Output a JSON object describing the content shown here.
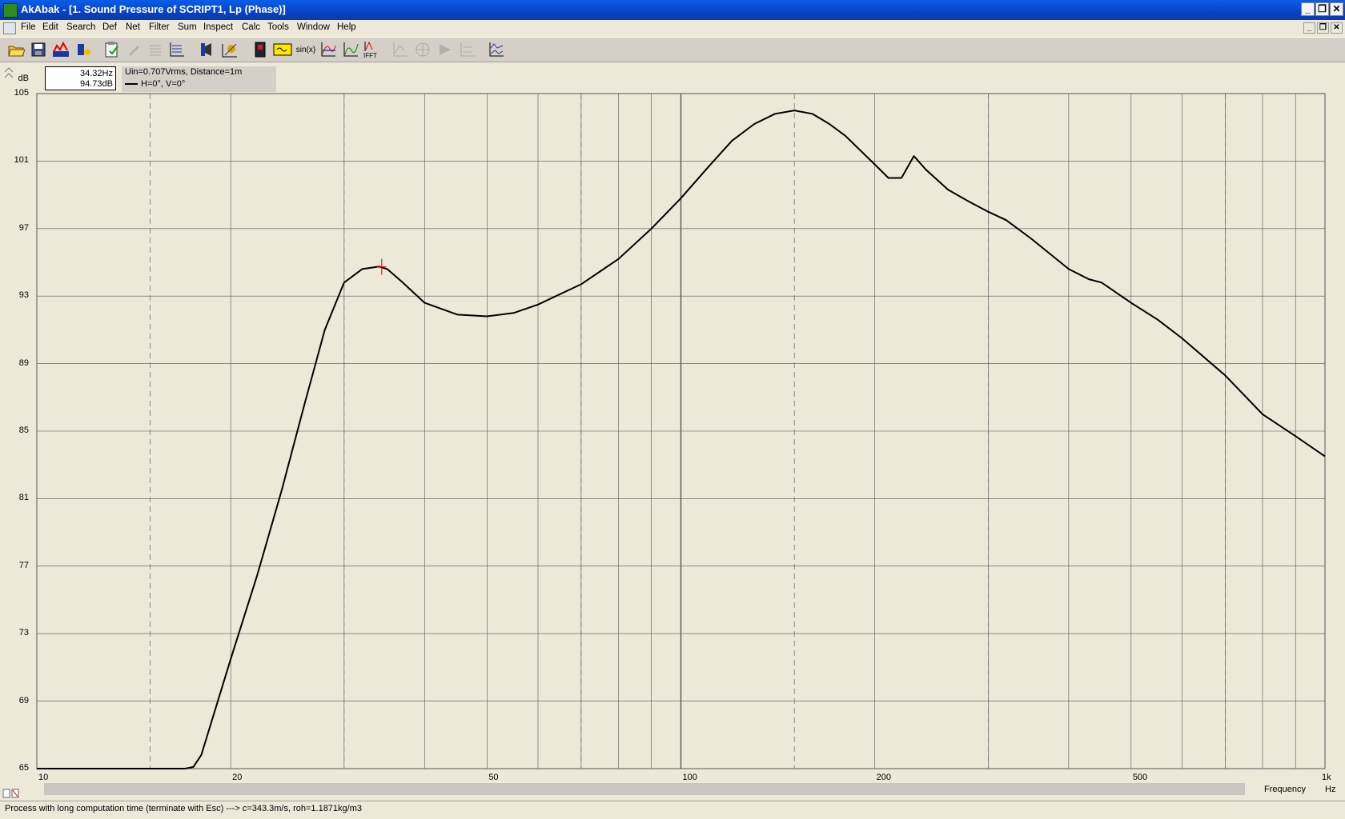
{
  "window": {
    "title": "AkAbak - [1. Sound Pressure of SCRIPT1, Lp (Phase)]"
  },
  "menu": [
    "File",
    "Edit",
    "Search",
    "Def",
    "Net",
    "Filter",
    "Sum",
    "Inspect",
    "Calc",
    "Tools",
    "Window",
    "Help"
  ],
  "toolbar": {
    "buttons": [
      {
        "icon": "open-folder-icon",
        "enabled": true
      },
      {
        "icon": "save-disk-icon",
        "enabled": true
      },
      {
        "icon": "run-chart-icon",
        "enabled": true
      },
      {
        "icon": "speaker-probe-icon",
        "enabled": true
      },
      {
        "icon": "clipboard-icon",
        "enabled": true
      },
      {
        "icon": "pen-icon",
        "enabled": false
      },
      {
        "icon": "list-lines-icon",
        "enabled": false
      },
      {
        "icon": "axes-icon",
        "enabled": true
      },
      {
        "icon": "speaker-icon",
        "enabled": true
      },
      {
        "icon": "measure-icon",
        "enabled": true
      },
      {
        "icon": "device-icon",
        "enabled": true
      },
      {
        "icon": "filter-box-icon",
        "enabled": true
      },
      {
        "icon": "sine-icon",
        "label": "sin(x)",
        "enabled": true
      },
      {
        "icon": "curve-a-icon",
        "enabled": true
      },
      {
        "icon": "curve-b-icon",
        "enabled": true
      },
      {
        "icon": "ifft-icon",
        "label": "IFFT",
        "enabled": true
      },
      {
        "icon": "disabled-a-icon",
        "enabled": false
      },
      {
        "icon": "disabled-b-icon",
        "enabled": false
      },
      {
        "icon": "disabled-c-icon",
        "enabled": false
      },
      {
        "icon": "disabled-d-icon",
        "enabled": false
      },
      {
        "icon": "graph-compare-icon",
        "enabled": true
      }
    ]
  },
  "cursor": {
    "freq": "34.32Hz",
    "level": "94.73dB"
  },
  "legend": {
    "condition": "Uin=0.707Vrms, Distance=1m",
    "trace": "H=0°, V=0°"
  },
  "status": "Process with long computation time (terminate with Esc) ---> c=343.3m/s, roh=1.1871kg/m3",
  "colors": {
    "curve": "#000000",
    "cursor": "#cc0000",
    "plot_bg": "#ece9d8"
  },
  "chart_data": {
    "type": "line",
    "x_scale": "log",
    "title": "Sound Pressure of SCRIPT1, Lp (Phase)",
    "ylabel": "dB",
    "xlabel": "Frequency",
    "x_unit": "Hz",
    "xlim": [
      10,
      1000
    ],
    "ylim": [
      65,
      105
    ],
    "yticks": [
      105,
      101,
      97,
      93,
      89,
      85,
      81,
      77,
      73,
      69,
      65
    ],
    "xtick_labels": [
      {
        "v": 10,
        "label": "10"
      },
      {
        "v": 20,
        "label": "20"
      },
      {
        "v": 50,
        "label": "50"
      },
      {
        "v": 100,
        "label": "100"
      },
      {
        "v": 200,
        "label": "200"
      },
      {
        "v": 500,
        "label": "500"
      },
      {
        "v": 1000,
        "label": "1k"
      }
    ],
    "grid": true,
    "cursor_point": {
      "x": 34.32,
      "y": 94.73
    },
    "series": [
      {
        "x": [
          10,
          15,
          17,
          17.5,
          18,
          20,
          22,
          24,
          26,
          28,
          30,
          32,
          34,
          35,
          37,
          40,
          45,
          50,
          55,
          60,
          70,
          80,
          90,
          100,
          110,
          120,
          130,
          140,
          150,
          160,
          170,
          180,
          200,
          210,
          220,
          230,
          240,
          260,
          280,
          300,
          320,
          350,
          400,
          430,
          450,
          500,
          550,
          600,
          700,
          800,
          900,
          1000
        ],
        "y": [
          65.0,
          65.0,
          65.0,
          65.1,
          65.8,
          71.5,
          76.5,
          81.5,
          86.5,
          91.0,
          93.8,
          94.6,
          94.75,
          94.6,
          93.8,
          92.6,
          91.9,
          91.8,
          92.0,
          92.5,
          93.7,
          95.2,
          97.0,
          98.8,
          100.6,
          102.2,
          103.2,
          103.8,
          104.0,
          103.8,
          103.2,
          102.5,
          100.8,
          100.0,
          100.0,
          101.3,
          100.5,
          99.3,
          98.6,
          98.0,
          97.5,
          96.4,
          94.6,
          94.0,
          93.8,
          92.6,
          91.6,
          90.5,
          88.3,
          86.0,
          84.7,
          83.5
        ]
      }
    ]
  }
}
